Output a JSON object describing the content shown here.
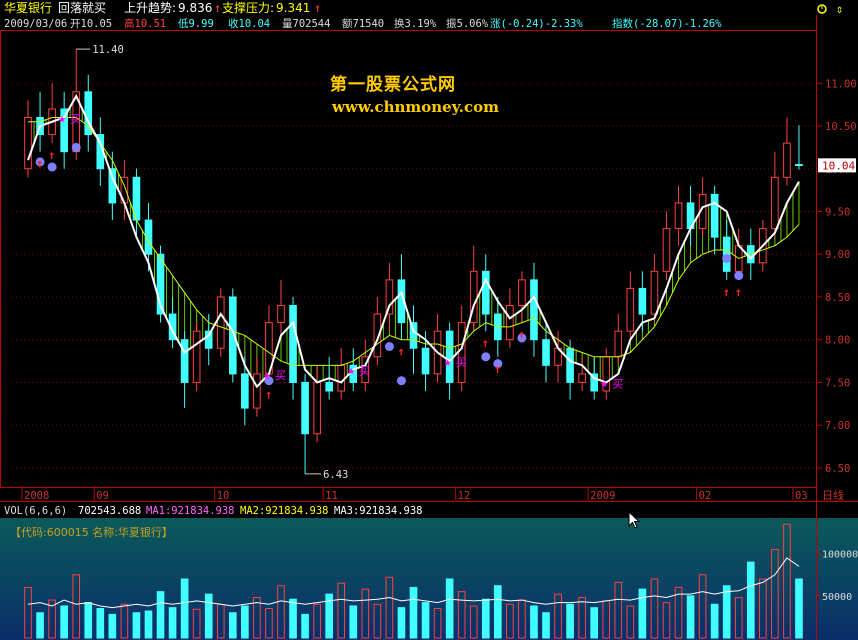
{
  "header": {
    "stock_name": "华夏银行",
    "indicator_name": "回落就买",
    "trend_label": "上升趋势:",
    "trend_value": "9.836",
    "support_label": "支撑压力:",
    "support_value": "9.341"
  },
  "info": {
    "date": "2009/03/06",
    "open": "开10.05",
    "high": "高10.51",
    "low": "低9.99",
    "close": "收10.04",
    "volume": "量702544",
    "amount": "额71540",
    "turnover": "换3.19%",
    "amplitude": "振5.06%",
    "change": "涨(-0.24)-2.33%",
    "index": "指数(-28.07)-1.26%"
  },
  "watermark": {
    "line1": "第一股票公式网",
    "line2": "www.chnmoney.com"
  },
  "annotations": {
    "high_marker": "11.40",
    "low_marker": "6.43",
    "buy_label": "买"
  },
  "current_price": "10.04",
  "period_button": "日线",
  "volume_panel": {
    "header": "VOL(6,6,6)",
    "value": "702543.688",
    "ma1": "MA1:921834.938",
    "ma2": "MA2:921834.938",
    "ma3": "MA3:921834.938",
    "code_label": "【代码:600015 名称:华夏银行】",
    "ticks": [
      "100000",
      "50000"
    ]
  },
  "colors": {
    "up": "#ff4040",
    "down": "#40ffff",
    "trend": "#ffffff",
    "support": "#ccff00",
    "buy": "#ff00ff",
    "marker": "#8080ff"
  },
  "chart_data": {
    "type": "candlestick",
    "y_ticks": [
      "11.00",
      "10.50",
      "10.00",
      "9.50",
      "9.00",
      "8.50",
      "8.00",
      "7.50",
      "7.00",
      "6.50"
    ],
    "x_labels": [
      "2008",
      "09",
      "10",
      "11",
      "12",
      "2009",
      "02",
      "03"
    ],
    "ylim": [
      6.3,
      11.6
    ],
    "trend_line": [
      10.1,
      10.5,
      10.55,
      10.6,
      10.85,
      10.55,
      10.3,
      9.9,
      9.6,
      9.2,
      8.9,
      8.4,
      8.1,
      7.85,
      7.95,
      8.05,
      8.3,
      8.1,
      7.7,
      7.45,
      7.6,
      8.05,
      8.2,
      7.65,
      7.5,
      7.55,
      7.5,
      7.65,
      7.7,
      8.0,
      8.4,
      8.55,
      8.1,
      8.0,
      7.85,
      7.75,
      7.9,
      8.4,
      8.7,
      8.45,
      8.25,
      8.35,
      8.5,
      8.2,
      7.9,
      7.75,
      7.7,
      7.55,
      7.5,
      7.6,
      8.0,
      8.2,
      8.25,
      8.6,
      9.0,
      9.3,
      9.55,
      9.6,
      9.5,
      9.1,
      8.95,
      9.1,
      9.25,
      9.6,
      9.85
    ],
    "support_line": [
      10.55,
      10.55,
      10.6,
      10.6,
      10.6,
      10.5,
      10.3,
      10.1,
      9.8,
      9.4,
      9.15,
      8.95,
      8.75,
      8.55,
      8.35,
      8.2,
      8.15,
      8.1,
      8.05,
      7.95,
      7.85,
      7.75,
      7.7,
      7.7,
      7.7,
      7.7,
      7.7,
      7.75,
      7.85,
      7.95,
      8.05,
      8.0,
      8.0,
      7.95,
      7.95,
      7.9,
      7.95,
      8.1,
      8.2,
      8.15,
      8.15,
      8.2,
      8.25,
      8.1,
      8.0,
      7.9,
      7.85,
      7.8,
      7.8,
      7.8,
      7.85,
      8.0,
      8.15,
      8.4,
      8.7,
      8.9,
      9.0,
      9.05,
      9.05,
      8.95,
      9.0,
      9.05,
      9.1,
      9.2,
      9.35
    ],
    "candles": [
      [
        10.0,
        10.6,
        10.8,
        9.9
      ],
      [
        10.6,
        10.4,
        10.9,
        10.2
      ],
      [
        10.4,
        10.7,
        11.0,
        10.3
      ],
      [
        10.7,
        10.2,
        10.9,
        10.0
      ],
      [
        10.2,
        10.9,
        11.4,
        10.1
      ],
      [
        10.9,
        10.4,
        11.1,
        10.2
      ],
      [
        10.4,
        10.0,
        10.6,
        9.8
      ],
      [
        10.0,
        9.6,
        10.2,
        9.4
      ],
      [
        9.6,
        9.9,
        10.1,
        9.4
      ],
      [
        9.9,
        9.4,
        10.0,
        9.2
      ],
      [
        9.4,
        9.0,
        9.6,
        8.8
      ],
      [
        9.0,
        8.3,
        9.1,
        8.2
      ],
      [
        8.3,
        8.0,
        8.5,
        7.9
      ],
      [
        8.0,
        7.5,
        8.1,
        7.2
      ],
      [
        7.5,
        8.1,
        8.2,
        7.4
      ],
      [
        8.1,
        7.9,
        8.3,
        7.7
      ],
      [
        7.9,
        8.5,
        8.6,
        7.8
      ],
      [
        8.5,
        7.6,
        8.6,
        7.5
      ],
      [
        7.6,
        7.2,
        7.8,
        7.0
      ],
      [
        7.2,
        7.6,
        7.8,
        7.1
      ],
      [
        7.6,
        8.2,
        8.4,
        7.5
      ],
      [
        8.2,
        8.4,
        8.7,
        8.0
      ],
      [
        8.4,
        7.5,
        8.5,
        7.3
      ],
      [
        7.5,
        6.9,
        7.6,
        6.43
      ],
      [
        6.9,
        7.5,
        7.7,
        6.8
      ],
      [
        7.5,
        7.4,
        7.8,
        7.3
      ],
      [
        7.4,
        7.7,
        7.9,
        7.3
      ],
      [
        7.7,
        7.5,
        7.9,
        7.4
      ],
      [
        7.5,
        7.8,
        8.0,
        7.4
      ],
      [
        7.8,
        8.3,
        8.5,
        7.7
      ],
      [
        8.3,
        8.7,
        8.9,
        8.1
      ],
      [
        8.7,
        8.2,
        9.0,
        8.0
      ],
      [
        8.2,
        7.9,
        8.4,
        7.6
      ],
      [
        7.9,
        7.6,
        8.1,
        7.4
      ],
      [
        7.6,
        8.1,
        8.3,
        7.5
      ],
      [
        8.1,
        7.5,
        8.2,
        7.3
      ],
      [
        7.5,
        8.2,
        8.4,
        7.4
      ],
      [
        8.2,
        8.8,
        9.1,
        8.1
      ],
      [
        8.8,
        8.3,
        9.0,
        8.1
      ],
      [
        8.3,
        8.0,
        8.5,
        7.8
      ],
      [
        8.0,
        8.4,
        8.6,
        7.9
      ],
      [
        8.4,
        8.7,
        8.8,
        8.2
      ],
      [
        8.7,
        8.0,
        8.9,
        7.8
      ],
      [
        8.0,
        7.7,
        8.2,
        7.5
      ],
      [
        7.7,
        7.9,
        8.1,
        7.5
      ],
      [
        7.9,
        7.5,
        8.0,
        7.3
      ],
      [
        7.5,
        7.6,
        7.8,
        7.4
      ],
      [
        7.6,
        7.4,
        7.8,
        7.3
      ],
      [
        7.4,
        7.8,
        7.9,
        7.3
      ],
      [
        7.8,
        8.1,
        8.3,
        7.7
      ],
      [
        8.1,
        8.6,
        8.8,
        8.0
      ],
      [
        8.6,
        8.3,
        8.8,
        8.1
      ],
      [
        8.3,
        8.8,
        9.0,
        8.2
      ],
      [
        8.8,
        9.3,
        9.5,
        8.7
      ],
      [
        9.3,
        9.6,
        9.8,
        9.1
      ],
      [
        9.6,
        9.3,
        9.8,
        9.1
      ],
      [
        9.3,
        9.7,
        9.9,
        9.2
      ],
      [
        9.7,
        9.2,
        9.8,
        9.0
      ],
      [
        9.2,
        8.8,
        9.4,
        8.7
      ],
      [
        8.8,
        9.1,
        9.3,
        8.7
      ],
      [
        9.1,
        8.9,
        9.3,
        8.7
      ],
      [
        8.9,
        9.3,
        9.4,
        8.8
      ],
      [
        9.3,
        9.9,
        10.2,
        9.2
      ],
      [
        9.9,
        10.3,
        10.6,
        9.8
      ],
      [
        10.05,
        10.04,
        10.51,
        9.99
      ]
    ],
    "buy_signals": [
      3,
      20,
      27,
      35,
      48
    ],
    "dot_markers": [
      [
        1,
        10.08
      ],
      [
        2,
        10.02
      ],
      [
        4,
        10.25
      ],
      [
        20,
        7.52
      ],
      [
        30,
        7.92
      ],
      [
        31,
        7.52
      ],
      [
        38,
        7.8
      ],
      [
        39,
        7.72
      ],
      [
        41,
        8.02
      ],
      [
        58,
        8.95
      ],
      [
        59,
        8.75
      ]
    ],
    "up_arrows": [
      1,
      2,
      20,
      31,
      38,
      39,
      41,
      58,
      59
    ],
    "volume": {
      "ylim": [
        0,
        140000
      ],
      "values": [
        60000,
        30000,
        45000,
        38000,
        75000,
        42000,
        35000,
        28000,
        40000,
        30000,
        32000,
        55000,
        36000,
        70000,
        34000,
        52000,
        40000,
        30000,
        38000,
        48000,
        35000,
        62000,
        46000,
        28000,
        40000,
        52000,
        65000,
        38000,
        58000,
        40000,
        72000,
        36000,
        60000,
        42000,
        35000,
        70000,
        55000,
        38000,
        46000,
        62000,
        40000,
        45000,
        38000,
        30000,
        52000,
        40000,
        48000,
        36000,
        44000,
        66000,
        38000,
        58000,
        70000,
        42000,
        60000,
        50000,
        75000,
        40000,
        62000,
        48000,
        90000,
        70000,
        105000,
        135000,
        70000
      ],
      "ma_line": [
        40000,
        42000,
        38000,
        45000,
        40000,
        42000,
        38000,
        36000,
        38000,
        40000,
        38000,
        42000,
        40000,
        42000,
        44000,
        42000,
        40000,
        38000,
        40000,
        42000,
        40000,
        44000,
        42000,
        40000,
        42000,
        44000,
        46000,
        44000,
        45000,
        46000,
        48000,
        44000,
        46000,
        44000,
        42000,
        46000,
        45000,
        44000,
        45000,
        46000,
        44000,
        45000,
        42000,
        40000,
        42000,
        42000,
        43000,
        42000,
        44000,
        46000,
        45000,
        48000,
        50000,
        48000,
        52000,
        52000,
        55000,
        52000,
        55000,
        56000,
        62000,
        66000,
        75000,
        95000,
        85000
      ]
    }
  }
}
